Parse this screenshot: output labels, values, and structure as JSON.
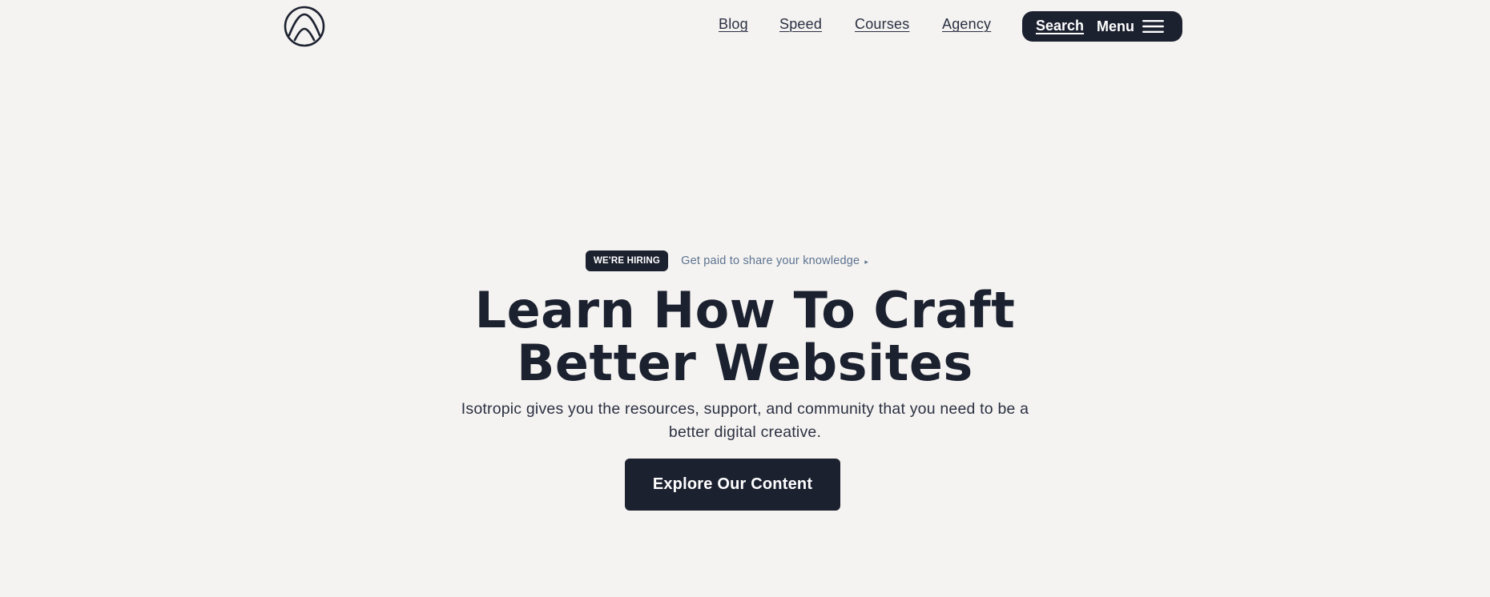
{
  "header": {
    "logo_icon": "arch-circle-logo-icon",
    "nav": [
      {
        "label": "Blog"
      },
      {
        "label": "Speed"
      },
      {
        "label": "Courses"
      },
      {
        "label": "Agency"
      }
    ],
    "search_label": "Search",
    "menu_label": "Menu",
    "menu_icon": "hamburger-icon"
  },
  "hero": {
    "badge": "WE'RE HIRING",
    "hiring_link": "Get paid to share your knowledge",
    "hiring_arrow": "▸",
    "headline_line1": "Learn How To Craft",
    "headline_line2": "Better Websites",
    "sub_line1": "Isotropic gives you the resources, support, and community that you need to be a",
    "sub_line2": "better digital creative.",
    "cta_label": "Explore Our Content"
  },
  "colors": {
    "background": "#f4f3f1",
    "dark": "#1c2130",
    "link_muted": "#5d7390",
    "on_dark": "#ffffff"
  }
}
